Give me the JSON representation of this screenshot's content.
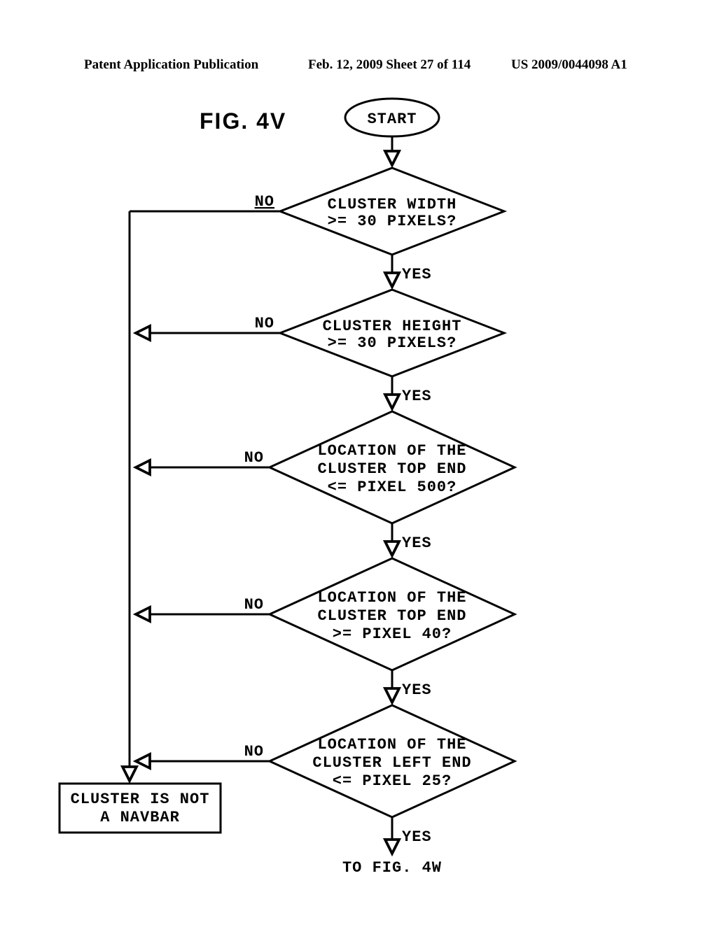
{
  "header": {
    "left": "Patent Application Publication",
    "center": "Feb. 12, 2009  Sheet 27 of 114",
    "right": "US 2009/0044098 A1"
  },
  "figure_label": "FIG.  4V",
  "flow": {
    "start": "START",
    "d1": {
      "l1": "CLUSTER WIDTH",
      "l2": ">= 30 PIXELS?"
    },
    "d2": {
      "l1": "CLUSTER HEIGHT",
      "l2": ">= 30 PIXELS?"
    },
    "d3": {
      "l1": "LOCATION OF THE",
      "l2": "CLUSTER TOP END",
      "l3": "<= PIXEL 500?"
    },
    "d4": {
      "l1": "LOCATION OF THE",
      "l2": "CLUSTER TOP END",
      "l3": ">= PIXEL 40?"
    },
    "d5": {
      "l1": "LOCATION OF THE",
      "l2": "CLUSTER LEFT END",
      "l3": "<= PIXEL 25?"
    },
    "result_no": {
      "l1": "CLUSTER IS NOT",
      "l2": "A NAVBAR"
    },
    "edges": {
      "yes": "YES",
      "no": "NO"
    },
    "continuation": "TO FIG. 4W"
  },
  "chart_data": {
    "type": "flowchart",
    "title": "FIG. 4V",
    "nodes": [
      {
        "id": "start",
        "kind": "terminator",
        "label": "START"
      },
      {
        "id": "d1",
        "kind": "decision",
        "label": "CLUSTER WIDTH >= 30 PIXELS?"
      },
      {
        "id": "d2",
        "kind": "decision",
        "label": "CLUSTER HEIGHT >= 30 PIXELS?"
      },
      {
        "id": "d3",
        "kind": "decision",
        "label": "LOCATION OF THE CLUSTER TOP END <= PIXEL 500?"
      },
      {
        "id": "d4",
        "kind": "decision",
        "label": "LOCATION OF THE CLUSTER TOP END >= PIXEL 40?"
      },
      {
        "id": "d5",
        "kind": "decision",
        "label": "LOCATION OF THE CLUSTER LEFT END <= PIXEL 25?"
      },
      {
        "id": "not_navbar",
        "kind": "process",
        "label": "CLUSTER IS NOT A NAVBAR"
      },
      {
        "id": "to_4W",
        "kind": "offpage",
        "label": "TO FIG. 4W"
      }
    ],
    "edges": [
      {
        "from": "start",
        "to": "d1",
        "label": ""
      },
      {
        "from": "d1",
        "to": "d2",
        "label": "YES"
      },
      {
        "from": "d1",
        "to": "not_navbar",
        "label": "NO"
      },
      {
        "from": "d2",
        "to": "d3",
        "label": "YES"
      },
      {
        "from": "d2",
        "to": "not_navbar",
        "label": "NO"
      },
      {
        "from": "d3",
        "to": "d4",
        "label": "YES"
      },
      {
        "from": "d3",
        "to": "not_navbar",
        "label": "NO"
      },
      {
        "from": "d4",
        "to": "d5",
        "label": "YES"
      },
      {
        "from": "d4",
        "to": "not_navbar",
        "label": "NO"
      },
      {
        "from": "d5",
        "to": "to_4W",
        "label": "YES"
      },
      {
        "from": "d5",
        "to": "not_navbar",
        "label": "NO"
      }
    ]
  }
}
